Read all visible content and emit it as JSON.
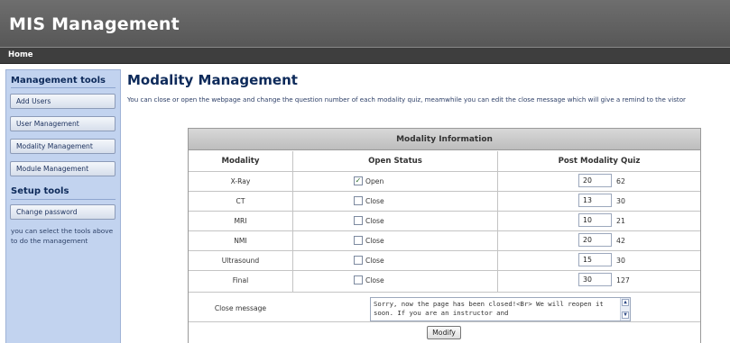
{
  "header": {
    "title": "MIS Management"
  },
  "nav": {
    "home": "Home"
  },
  "sidebar": {
    "management_title": "Management tools",
    "management_items": [
      "Add Users",
      "User Management",
      "Modality Management",
      "Module Management"
    ],
    "setup_title": "Setup tools",
    "setup_items": [
      "Change password"
    ],
    "help_text": "you can select the tools above to do the management"
  },
  "main": {
    "title": "Modality Management",
    "description": "You can close or open the webpage and change the question number of each modality quiz, meamwhile you can edit the close message which will give a remind to the vistor"
  },
  "table": {
    "caption": "Modality Information",
    "headers": [
      "Modality",
      "Open Status",
      "Post Modality Quiz"
    ],
    "rows": [
      {
        "modality": "X-Ray",
        "checked": true,
        "status": "Open",
        "quiz": "20",
        "count": "62"
      },
      {
        "modality": "CT",
        "checked": false,
        "status": "Close",
        "quiz": "13",
        "count": "30"
      },
      {
        "modality": "MRI",
        "checked": false,
        "status": "Close",
        "quiz": "10",
        "count": "21"
      },
      {
        "modality": "NMI",
        "checked": false,
        "status": "Close",
        "quiz": "20",
        "count": "42"
      },
      {
        "modality": "Ultrasound",
        "checked": false,
        "status": "Close",
        "quiz": "15",
        "count": "30"
      },
      {
        "modality": "Final",
        "checked": false,
        "status": "Close",
        "quiz": "30",
        "count": "127"
      }
    ],
    "close_message_label": "Close message",
    "close_message_value": "Sorry, now the page has been closed!<Br> We will reopen it soon. If you are an instructor and",
    "modify_label": "Modify"
  }
}
